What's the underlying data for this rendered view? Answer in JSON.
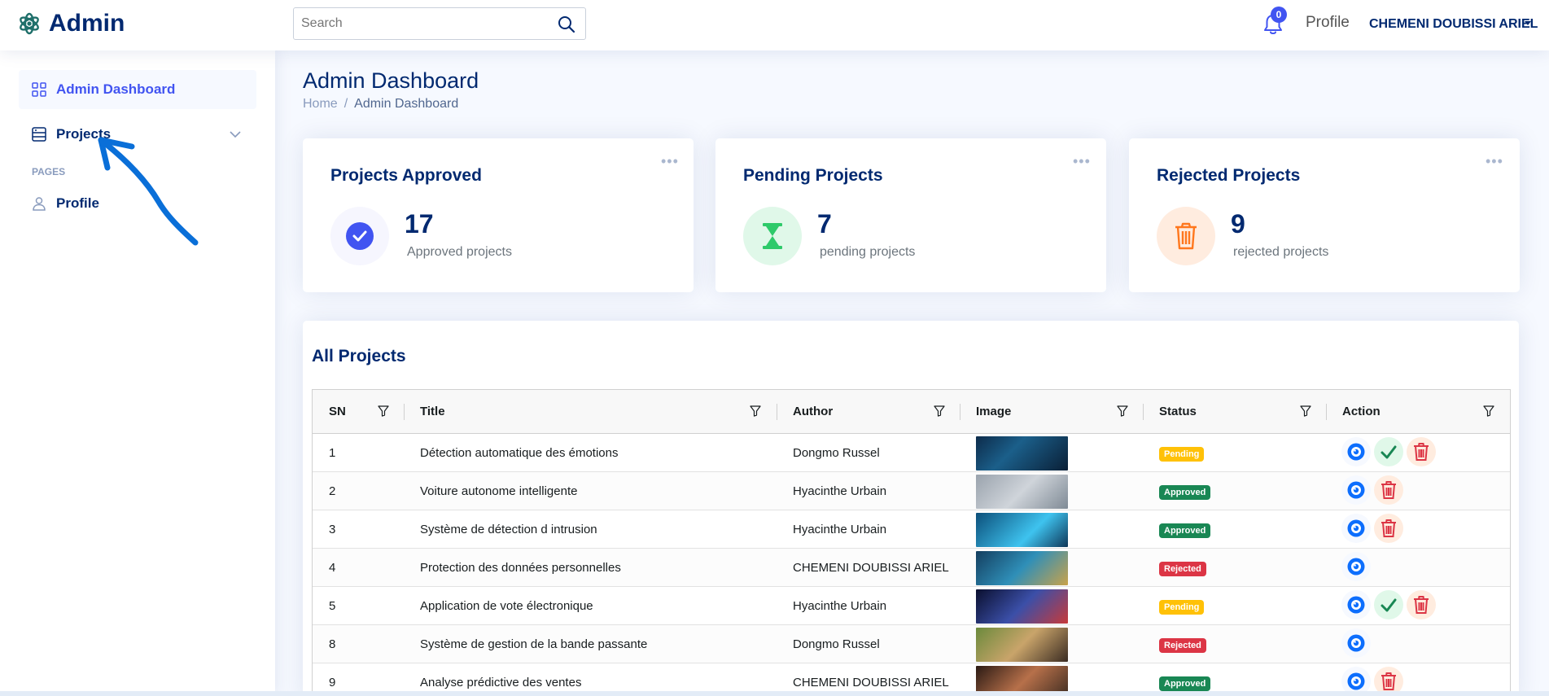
{
  "brand": {
    "name": "Admin"
  },
  "search": {
    "placeholder": "Search"
  },
  "notifications": {
    "count": "0"
  },
  "user": {
    "avatar_alt": "Profile",
    "name": "CHEMENI DOUBISSI ARIEL"
  },
  "sidebar": {
    "items": [
      {
        "label": "Admin Dashboard",
        "icon": "grid-icon",
        "active": true
      },
      {
        "label": "Projects",
        "icon": "layout-icon",
        "active": false
      }
    ],
    "pages_heading": "PAGES",
    "pages": [
      {
        "label": "Profile",
        "icon": "person-icon"
      }
    ]
  },
  "page": {
    "title": "Admin Dashboard",
    "breadcrumb": {
      "home": "Home",
      "separator": "/",
      "current": "Admin Dashboard"
    }
  },
  "cards": [
    {
      "title": "Projects Approved",
      "value": "17",
      "subtitle": "Approved projects",
      "icon": "check-circle-icon",
      "tint": "#f6f6fe",
      "color": "#4154f1"
    },
    {
      "title": "Pending Projects",
      "value": "7",
      "subtitle": "pending projects",
      "icon": "hourglass-icon",
      "tint": "#e0f8e9",
      "color": "#2eca6a"
    },
    {
      "title": "Rejected Projects",
      "value": "9",
      "subtitle": "rejected projects",
      "icon": "trash-icon",
      "tint": "#ffecdf",
      "color": "#ff771d"
    }
  ],
  "table": {
    "title": "All Projects",
    "columns": [
      "SN",
      "Title",
      "Author",
      "Image",
      "Status",
      "Action"
    ],
    "rows": [
      {
        "sn": "1",
        "title": "Détection automatique des émotions",
        "author": "Dongmo Russel",
        "status": "Pending",
        "actions": [
          "view",
          "approve",
          "delete"
        ]
      },
      {
        "sn": "2",
        "title": "Voiture autonome intelligente",
        "author": "Hyacinthe Urbain",
        "status": "Approved",
        "actions": [
          "view",
          "delete"
        ]
      },
      {
        "sn": "3",
        "title": "Système de détection d intrusion",
        "author": "Hyacinthe Urbain",
        "status": "Approved",
        "actions": [
          "view",
          "delete"
        ]
      },
      {
        "sn": "4",
        "title": "Protection des données personnelles",
        "author": "CHEMENI DOUBISSI ARIEL",
        "status": "Rejected",
        "actions": [
          "view"
        ]
      },
      {
        "sn": "5",
        "title": "Application de vote électronique",
        "author": "Hyacinthe Urbain",
        "status": "Pending",
        "actions": [
          "view",
          "approve",
          "delete"
        ]
      },
      {
        "sn": "8",
        "title": "Système de gestion de la bande passante",
        "author": "Dongmo Russel",
        "status": "Rejected",
        "actions": [
          "view"
        ]
      },
      {
        "sn": "9",
        "title": "Analyse prédictive des ventes",
        "author": "CHEMENI DOUBISSI ARIEL",
        "status": "Approved",
        "actions": [
          "view",
          "delete"
        ]
      }
    ]
  },
  "colors": {
    "accent": "#4154f1",
    "navy": "#012970",
    "approved": "#198754",
    "pending": "#ffc107",
    "rejected": "#dc3545"
  }
}
